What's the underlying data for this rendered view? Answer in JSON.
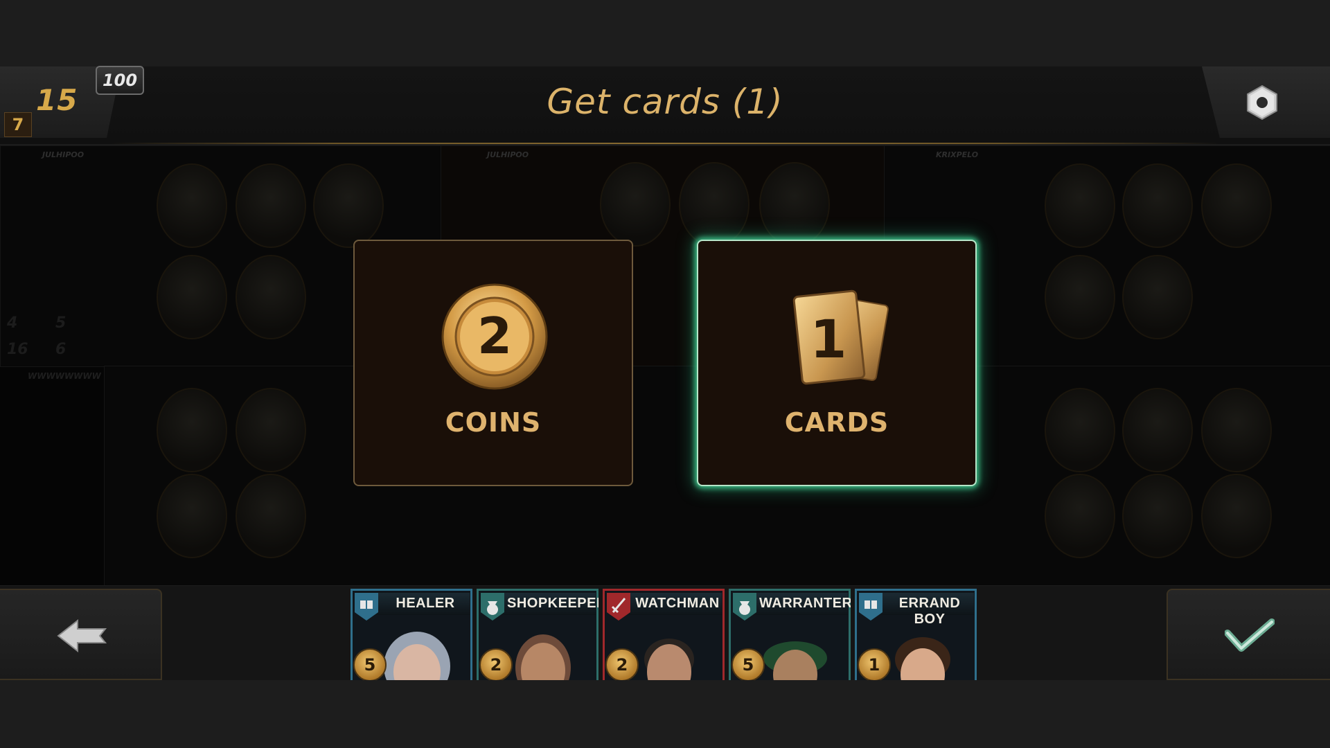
{
  "header": {
    "title": "Get cards (1)",
    "score_main": "15",
    "score_badge": "100",
    "score_small": "7",
    "settings_icon": "gear-icon"
  },
  "board": {
    "panels": [
      {
        "name": "JULHIPOO"
      },
      {
        "name": "JULHIPOO"
      },
      {
        "name": "KRIXPELO"
      }
    ],
    "left_stats": [
      "4",
      "5",
      "16",
      "6"
    ],
    "sub_name": "WWWWWWWW"
  },
  "choices": {
    "coins": {
      "amount": "2",
      "label": "COINS",
      "icon": "coin-icon"
    },
    "cards": {
      "amount": "1",
      "label": "CARDS",
      "icon": "cards-icon",
      "selected": true
    }
  },
  "hand": [
    {
      "name": "HEALER",
      "cost": "5",
      "role_icon": "book-icon",
      "color": "#2f6f8c"
    },
    {
      "name": "SHOPKEEPER",
      "cost": "2",
      "role_icon": "sack-icon",
      "color": "#2d6e6a"
    },
    {
      "name": "WATCHMAN",
      "cost": "2",
      "role_icon": "sword-icon",
      "color": "#a0282b"
    },
    {
      "name": "WARRANTER",
      "cost": "5",
      "role_icon": "sack-icon",
      "color": "#2d6e6a"
    },
    {
      "name": "ERRAND BOY",
      "cost": "1",
      "role_icon": "book-icon",
      "color": "#2f6f8c"
    }
  ],
  "controls": {
    "back_icon": "back-arrow-icon",
    "confirm_icon": "checkmark-icon"
  }
}
